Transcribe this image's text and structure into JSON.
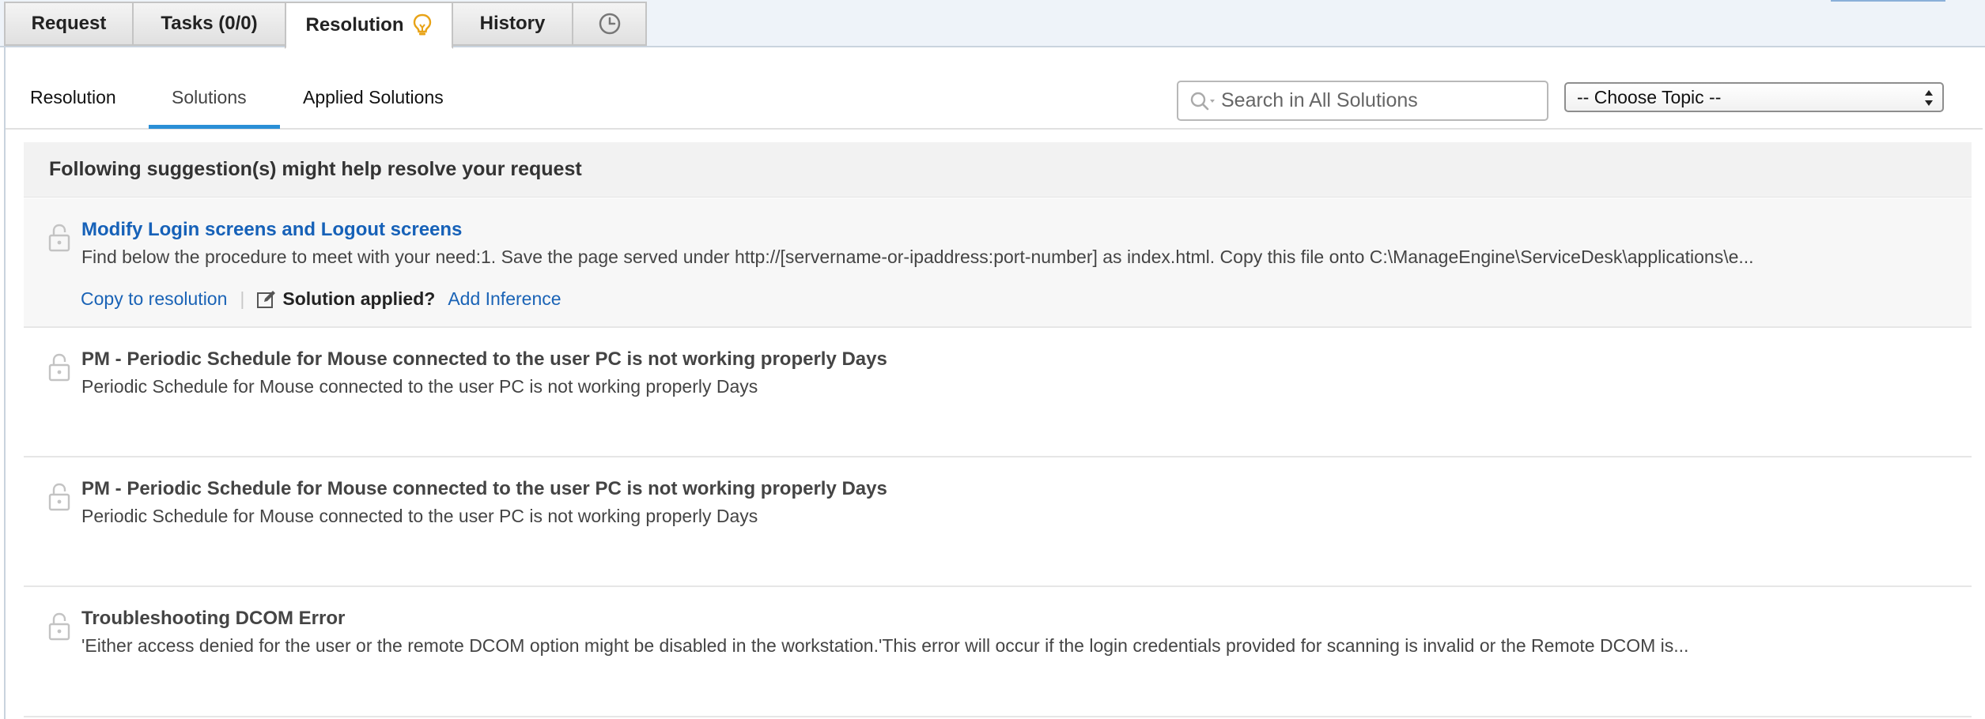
{
  "top_tabs": [
    {
      "label": "Request"
    },
    {
      "label": "Tasks (0/0)"
    },
    {
      "label": "Resolution",
      "active": true,
      "icon": "lightbulb-icon"
    },
    {
      "label": "History"
    },
    {
      "label": "",
      "icon": "clock-icon"
    }
  ],
  "sub_tabs": {
    "resolution": "Resolution",
    "solutions": "Solutions",
    "applied": "Applied Solutions",
    "active": "Solutions"
  },
  "search": {
    "placeholder": "Search in All Solutions",
    "value": ""
  },
  "topic_select": {
    "selected": "-- Choose Topic --"
  },
  "suggestions": {
    "header": "Following suggestion(s) might help resolve your request",
    "items": [
      {
        "title": "Modify Login screens and Logout screens",
        "description": "Find below the procedure to meet with your need:1. Save the page served under http://[servername-or-ipaddress:port-number] as index.html. Copy this file onto C:\\ManageEngine\\ServiceDesk\\applications\\e...",
        "actions": {
          "copy": "Copy to resolution",
          "separator": "|",
          "applied": "Solution applied?",
          "inference": "Add Inference"
        }
      },
      {
        "title": "PM - Periodic Schedule for Mouse connected to the user PC is not working properly Days",
        "description": "Periodic Schedule for Mouse connected to the user PC is not working properly Days"
      },
      {
        "title": "PM - Periodic Schedule for Mouse connected to the user PC is not working properly Days",
        "description": "Periodic Schedule for Mouse connected to the user PC is not working properly Days"
      },
      {
        "title": "Troubleshooting DCOM Error",
        "description": "'Either access denied for the user or the remote DCOM option might be disabled in the workstation.'This error will occur if the login credentials provided for scanning is invalid or the Remote DCOM is..."
      }
    ]
  },
  "colors": {
    "link": "#1a63b6",
    "active_underline": "#2a8fd6",
    "bulb": "#e8a317",
    "header_bg": "#f2f2f2"
  }
}
